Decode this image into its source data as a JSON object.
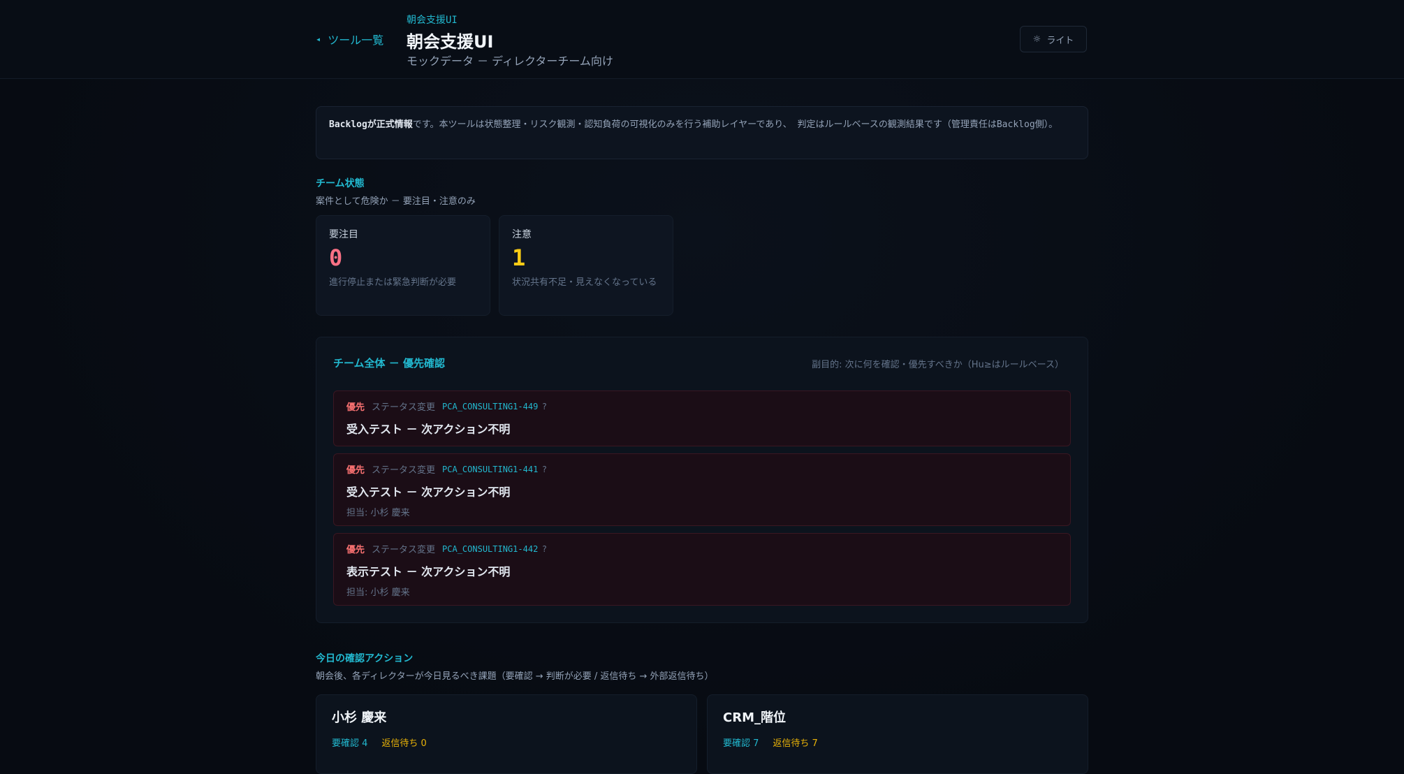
{
  "header": {
    "back_label": "ツール一覧",
    "eyebrow": "朝会支援UI",
    "title": "朝会支援UI",
    "subtitle": "モックデータ － ディレクターチーム向け",
    "theme_label": "ライト",
    "theme_icon": "sun-icon"
  },
  "notice": {
    "bold": "Backlogが正式情報",
    "text": "です。本ツールは状態整理・リスク観測・認知負荷の可視化のみを行う補助レイヤーであり、 判定はルールベースの観測結果です（管理責任はBacklog側）。"
  },
  "team_status": {
    "label": "チーム状態",
    "desc": "案件として危険か － 要注目・注意のみ",
    "cards": [
      {
        "label": "要注目",
        "value": "0",
        "note": "進行停止または緊急判断が必要",
        "color": "#fb7185"
      },
      {
        "label": "注意",
        "value": "1",
        "note": "状況共有不足・見えなくなっている",
        "color": "#facc15"
      }
    ]
  },
  "priority": {
    "title": "チーム全体 － 優先確認",
    "note": "副目的: 次に何を確認・優先すべきか（Hu≥はルールベース）",
    "items": [
      {
        "tag": "優先",
        "type": "ステータス変更",
        "key": "PCA_CONSULTING1-449",
        "q": "?",
        "title": "受入テスト － 次アクション不明",
        "assignee": ""
      },
      {
        "tag": "優先",
        "type": "ステータス変更",
        "key": "PCA_CONSULTING1-441",
        "q": "?",
        "title": "受入テスト － 次アクション不明",
        "assignee": "担当: 小杉 慶来"
      },
      {
        "tag": "優先",
        "type": "ステータス変更",
        "key": "PCA_CONSULTING1-442",
        "q": "?",
        "title": "表示テスト － 次アクション不明",
        "assignee": "担当: 小杉 慶来"
      }
    ]
  },
  "today": {
    "label": "今日の確認アクション",
    "desc": "朝会後、各ディレクターが今日見るべき課題（要確認 → 判断が必要 / 返信待ち → 外部返信待ち）",
    "people": [
      {
        "name": "小杉 慶来",
        "check": "要確認 4",
        "wait": "返信待ち 0"
      },
      {
        "name": "CRM_階位",
        "check": "要確認 7",
        "wait": "返信待ち 7"
      }
    ]
  }
}
